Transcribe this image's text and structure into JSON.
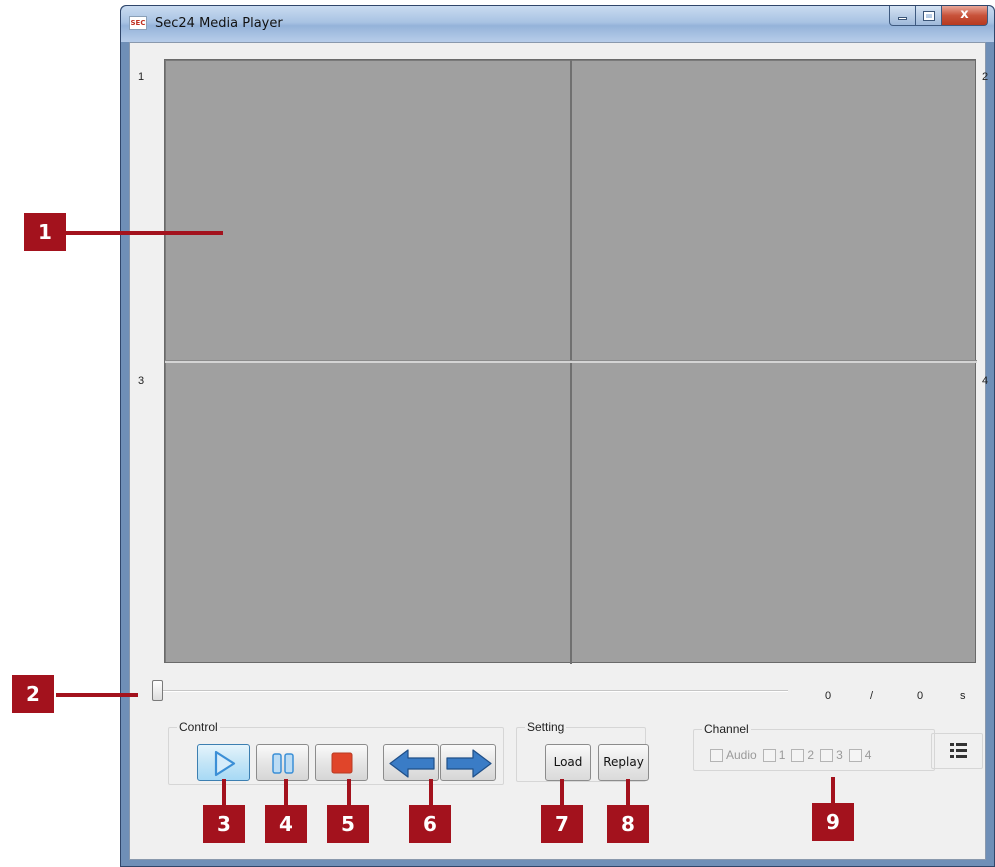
{
  "window": {
    "title": "Sec24 Media Player",
    "icon_text": "SEC",
    "close_glyph": "x"
  },
  "video": {
    "channels": [
      "1",
      "2",
      "3",
      "4"
    ]
  },
  "playback": {
    "position_fraction": 0,
    "current_time": "0",
    "separator": "/",
    "total_time": "0",
    "unit": "s"
  },
  "control_group": {
    "label": "Control",
    "buttons": [
      "play-icon",
      "pause-icon",
      "stop-icon",
      "previous-arrow-icon",
      "next-arrow-icon"
    ]
  },
  "setting_group": {
    "label": "Setting",
    "load_label": "Load",
    "replay_label": "Replay"
  },
  "channel_group": {
    "label": "Channel",
    "options": [
      "Audio",
      "1",
      "2",
      "3",
      "4"
    ]
  },
  "callouts": [
    "1",
    "2",
    "3",
    "4",
    "5",
    "6",
    "7",
    "8",
    "9"
  ],
  "colors": {
    "callout": "#a3121d",
    "play_icon": "#3b8fd6",
    "stop_icon": "#e0452a",
    "arrow_icon": "#2f6fb8"
  }
}
